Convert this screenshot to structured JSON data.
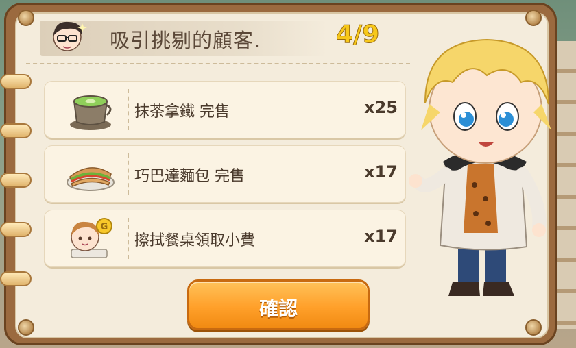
{
  "dialog": {
    "title": "吸引挑剔的顧客.",
    "progress": "4/9"
  },
  "tasks": [
    {
      "icon": "matcha-latte-icon",
      "label": "抹茶拿鐵 完售",
      "count": "x25"
    },
    {
      "icon": "ciabatta-sandwich-icon",
      "label": "巧巴達麵包 完售",
      "count": "x17"
    },
    {
      "icon": "customer-tip-icon",
      "label": "擦拭餐桌領取小費",
      "count": "x17"
    }
  ],
  "confirm_label": "確認",
  "colors": {
    "progress": "#f7c81a",
    "button": "#ffa02a",
    "board": "#9b6a3f",
    "paper": "#f4ecdc"
  }
}
